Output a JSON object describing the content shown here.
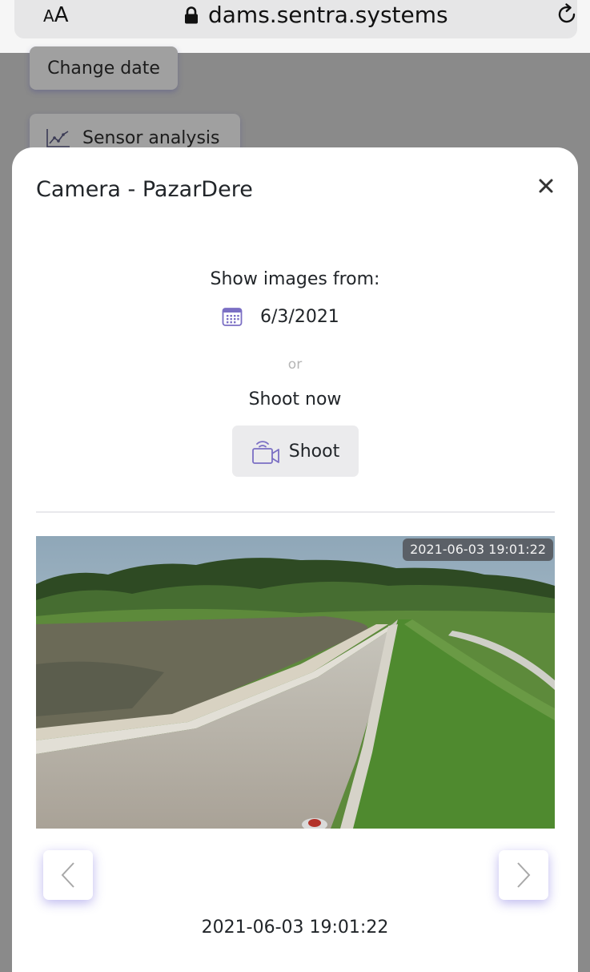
{
  "browser": {
    "text_size_label_small": "A",
    "text_size_label_large": "A",
    "url": "dams.sentra.systems"
  },
  "background_page": {
    "change_date_label": "Change date",
    "sensor_analysis_label": "Sensor analysis"
  },
  "modal": {
    "title": "Camera - PazarDere",
    "show_images_label": "Show images from:",
    "selected_date": "6/3/2021",
    "or_label": "or",
    "shoot_now_label": "Shoot now",
    "shoot_button_label": "Shoot",
    "image_timestamp": "2021-06-03 19:01:22",
    "caption": "2021-06-03 19:01:22"
  },
  "colors": {
    "accent_icon": "#7b6fc4",
    "nav_glow": "#8a7ff0"
  },
  "icons": {
    "lock": "lock-icon",
    "reload": "reload-icon",
    "chart": "line-chart-icon",
    "close": "close-icon",
    "calendar": "calendar-icon",
    "camera": "video-camera-icon",
    "prev": "chevron-left-icon",
    "next": "chevron-right-icon"
  }
}
